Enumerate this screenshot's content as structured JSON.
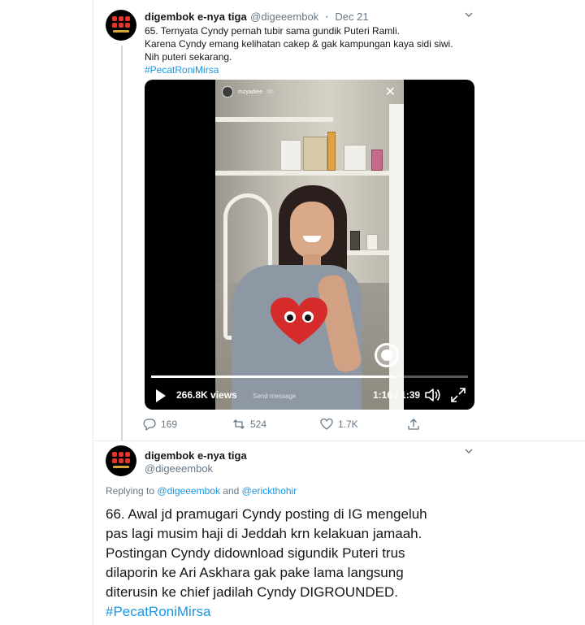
{
  "tweet1": {
    "display_name": "digembok e-nya tiga",
    "handle": "@digeeembok",
    "separator": "·",
    "date": "Dec 21",
    "lines": [
      "65. Ternyata Cyndy pernah tubir sama gundik Puteri Ramli.",
      "Karena Cyndy emang kelihatan cakep & gak kampungan kaya sidi siwi.",
      "Nih puteri sekarang."
    ],
    "hashtag": "#PecatRoniMirsa",
    "caret_icon": "chevron-down-icon",
    "video": {
      "story_user": "mzyadiee",
      "story_time": "6h",
      "send_placeholder": "Send message",
      "views": "266.8K views",
      "time": "1:16 / 1:39",
      "progress": 0.766
    },
    "actions": {
      "replies": "169",
      "retweets": "524",
      "likes": "1.7K"
    }
  },
  "tweet2": {
    "display_name": "digembok e-nya tiga",
    "handle": "@digeeembok",
    "replying_prefix": "Replying to",
    "replying_user1": "@digeeembok",
    "replying_and": "and",
    "replying_user2": "@erickthohir",
    "lines": [
      "66. Awal jd pramugari Cyndy posting di IG mengeluh",
      "pas lagi musim haji di Jeddah krn kelakuan jamaah.",
      "Postingan Cyndy didownload sigundik Puteri trus",
      "dilaporin ke Ari Askhara gak pake lama langsung",
      "diterusin ke chief jadilah Cyndy DIGROUNDED."
    ],
    "hashtag": "#PecatRoniMirsa"
  },
  "colors": {
    "link": "#1b95e0",
    "muted": "#657786",
    "text": "#14171a",
    "border": "#e6ecf0"
  }
}
